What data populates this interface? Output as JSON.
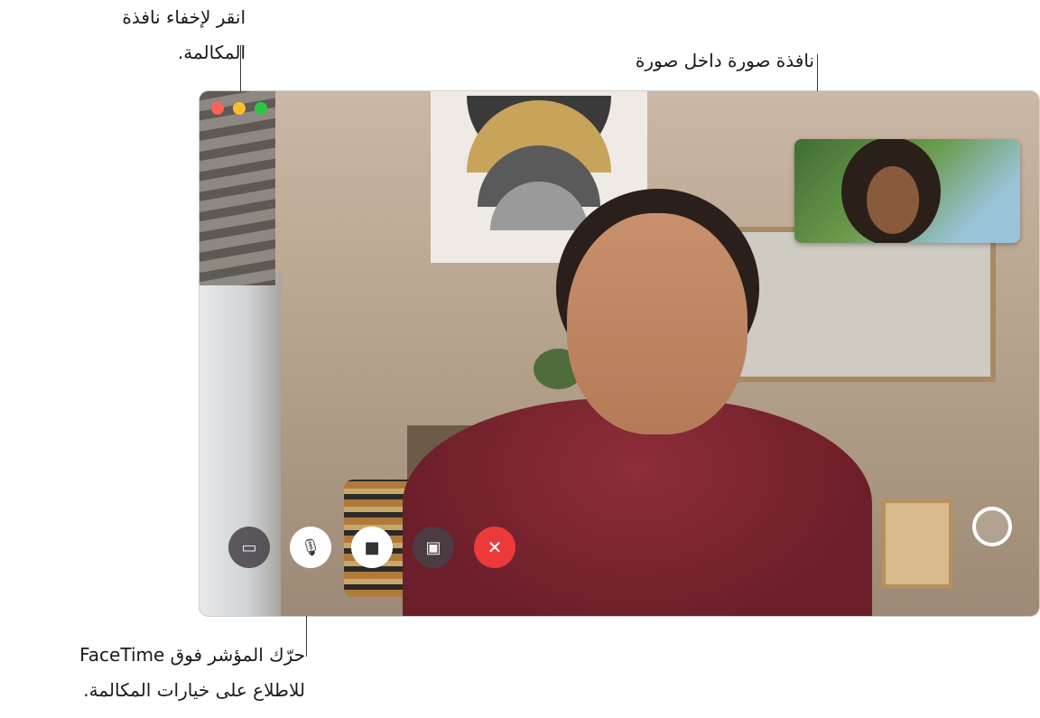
{
  "callouts": {
    "hide_window": "انقر لإخفاء نافذة\nالمكالمة.",
    "pip": "نافذة صورة داخل صورة",
    "hover_controls": "حرّك المؤشر فوق FaceTime\nللاطلاع على خيارات المكالمة."
  },
  "window": {
    "traffic_lights": [
      {
        "name": "close",
        "color": "#ff5f57"
      },
      {
        "name": "minimize",
        "color": "#febc2e"
      },
      {
        "name": "zoom",
        "color": "#28c840"
      }
    ]
  },
  "controls": [
    {
      "name": "sidebar-button",
      "icon": "sidebar-icon",
      "glyph": "▭"
    },
    {
      "name": "mute-button",
      "icon": "microphone-icon",
      "glyph": "🎙"
    },
    {
      "name": "video-button",
      "icon": "video-camera-icon",
      "glyph": "■"
    },
    {
      "name": "share-screen-button",
      "icon": "share-screen-icon",
      "glyph": "▣"
    },
    {
      "name": "end-call-button",
      "icon": "close-icon",
      "glyph": "✕"
    }
  ],
  "colors": {
    "end_call": "#ec3a3a",
    "leader_line": "#3a3a3a"
  }
}
